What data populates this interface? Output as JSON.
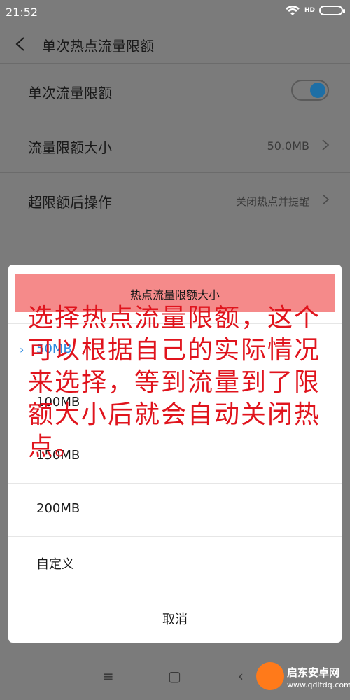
{
  "status_bar": {
    "time": "21:52",
    "network": "HD"
  },
  "header": {
    "title": "单次热点流量限额"
  },
  "settings": {
    "limit_toggle_label": "单次流量限额",
    "limit_toggle_on": true,
    "limit_size_label": "流量限额大小",
    "limit_size_value": "50.0MB",
    "after_limit_label": "超限额后操作",
    "after_limit_value": "关闭热点并提醒"
  },
  "dialog": {
    "title": "热点流量限额大小",
    "options": [
      {
        "label": "50MB",
        "selected": true
      },
      {
        "label": "100MB",
        "selected": false
      },
      {
        "label": "150MB",
        "selected": false
      },
      {
        "label": "200MB",
        "selected": false
      },
      {
        "label": "自定义",
        "selected": false
      }
    ],
    "cancel_label": "取消"
  },
  "annotation": "选择热点流量限额，这个可以根据自己的实际情况来选择，等到流量到了限额大小后就会自动关闭热点。",
  "watermark": {
    "name": "启东安卓网",
    "url": "www.qdltdq.com"
  },
  "colors": {
    "accent": "#2b8ae0",
    "annotation": "#e0141d",
    "title_highlight": "#f58a8a"
  }
}
